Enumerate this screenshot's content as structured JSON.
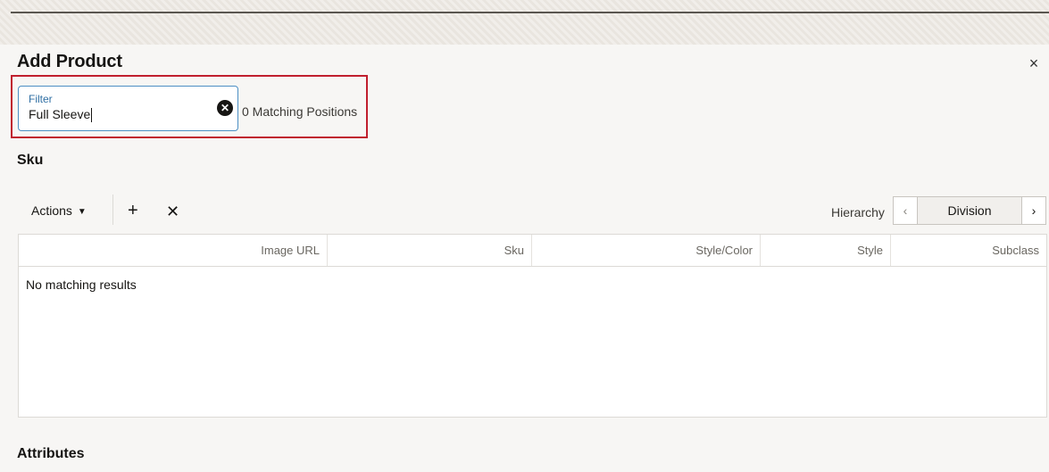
{
  "dialog": {
    "title": "Add Product",
    "close_glyph": "×"
  },
  "filter": {
    "label": "Filter",
    "value": "Full Sleeve",
    "clear_glyph": "✕",
    "matching_text": "0 Matching Positions"
  },
  "sku": {
    "heading": "Sku",
    "toolbar": {
      "actions_label": "Actions",
      "actions_caret": "▼",
      "add_glyph": "+",
      "remove_glyph": "✕"
    },
    "hierarchy": {
      "label": "Hierarchy",
      "value": "Division",
      "prev_glyph": "‹",
      "next_glyph": "›"
    },
    "table": {
      "columns": [
        "Image URL",
        "Sku",
        "Style/Color",
        "Style",
        "Subclass"
      ],
      "empty_message": "No matching results"
    }
  },
  "attributes": {
    "heading": "Attributes"
  },
  "colors": {
    "highlight": "#c01f2e",
    "filter_border": "#4c8fc4",
    "filter_label": "#2e6ea3"
  },
  "icons": {
    "close": "close-icon",
    "clear": "clear-filter-icon",
    "caret": "caret-down-icon",
    "add": "plus-icon",
    "remove": "x-icon",
    "prev": "chevron-left-icon",
    "next": "chevron-right-icon"
  }
}
